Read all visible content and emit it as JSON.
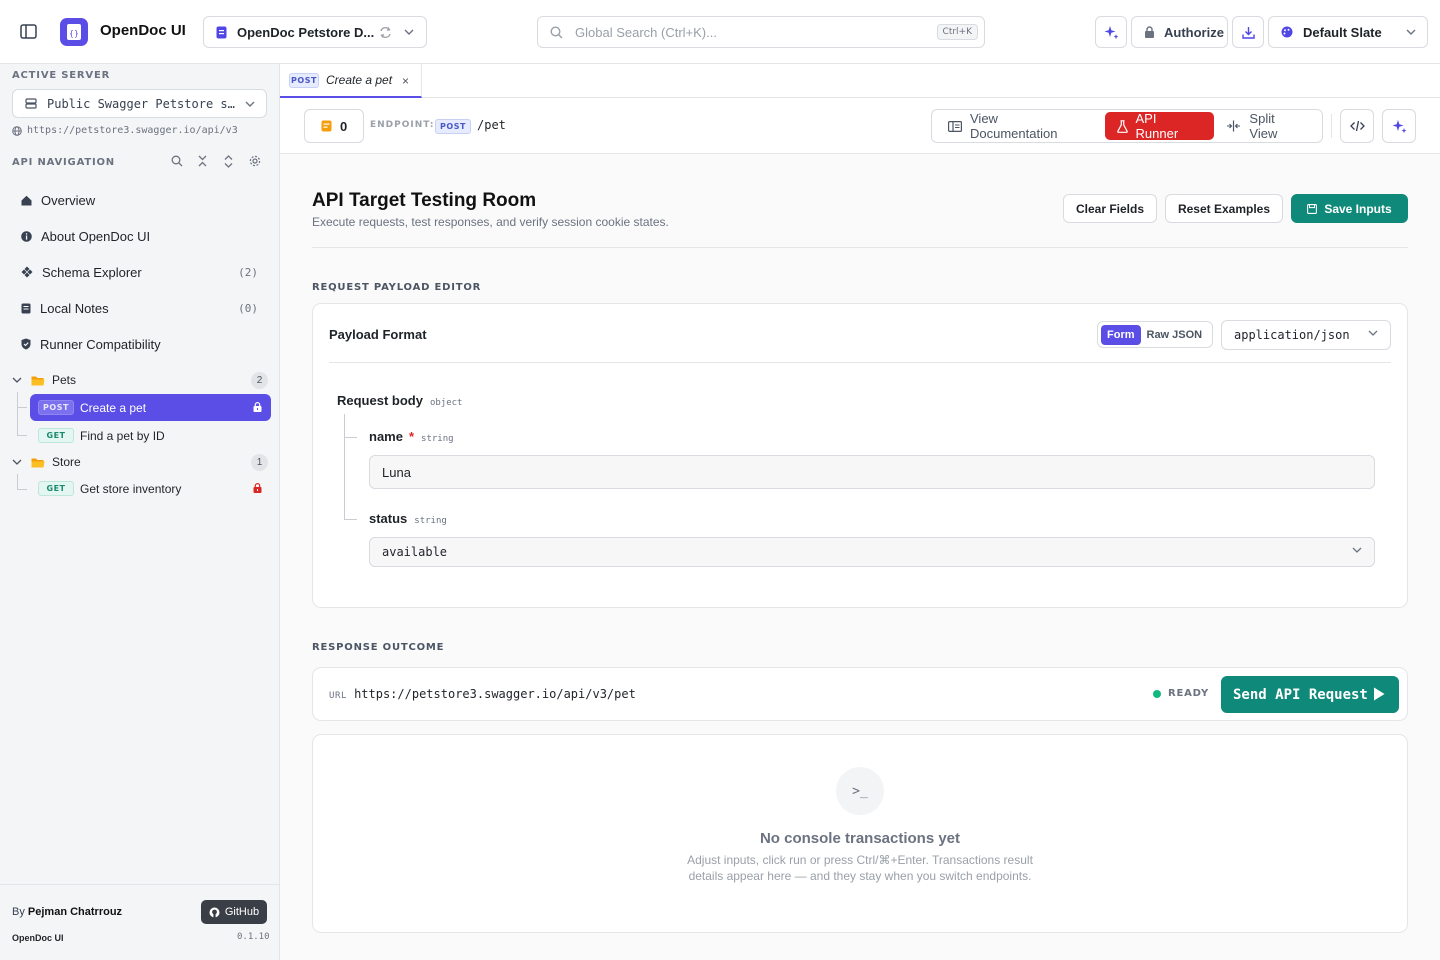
{
  "app": {
    "brand": "OpenDoc UI",
    "spec_selector": "OpenDoc Petstore D...",
    "search_placeholder": "Global Search (Ctrl+K)...",
    "search_kbd": "Ctrl+K",
    "authorize_label": "Authorize",
    "theme_label": "Default Slate",
    "accent": "#5b4ee6",
    "runner_red": "#dc2626",
    "success_teal": "#0f8a7a"
  },
  "sidebar": {
    "active_server_title": "ACTIVE SERVER",
    "server_name": "Public Swagger Petstore s…",
    "server_url": "https://petstore3.swagger.io/api/v3",
    "nav_title": "API NAVIGATION",
    "items": [
      {
        "label": "Overview",
        "icon": "home-icon",
        "count": ""
      },
      {
        "label": "About OpenDoc UI",
        "icon": "info-icon",
        "count": ""
      },
      {
        "label": "Schema Explorer",
        "icon": "schema-icon",
        "count": "(2)"
      },
      {
        "label": "Local Notes",
        "icon": "notes-icon",
        "count": "(0)"
      },
      {
        "label": "Runner Compatibility",
        "icon": "shield-icon",
        "count": ""
      }
    ],
    "groups": [
      {
        "label": "Pets",
        "count": "2",
        "endpoints": [
          {
            "method": "POST",
            "label": "Create a pet",
            "active": true,
            "lock": "locked"
          },
          {
            "method": "GET",
            "label": "Find a pet by ID",
            "active": false,
            "lock": ""
          }
        ]
      },
      {
        "label": "Store",
        "count": "1",
        "endpoints": [
          {
            "method": "GET",
            "label": "Get store inventory",
            "active": false,
            "lock": "locked-red"
          }
        ]
      }
    ],
    "footer": {
      "by": "By",
      "author": "Pejman Chatrrouz",
      "github_label": "GitHub",
      "app_name": "OpenDoc UI",
      "version": "0.1.10"
    }
  },
  "tab": {
    "method": "POST",
    "label": "Create a pet",
    "close": "×"
  },
  "endpoint_bar": {
    "notes_count": "0",
    "endpoint_label": "ENDPOINT:",
    "method": "POST",
    "path": "/pet",
    "view_buttons": [
      "View Documentation",
      "API Runner",
      "Split View"
    ]
  },
  "main": {
    "title": "API Target Testing Room",
    "subtitle": "Execute requests, test responses, and verify session cookie states.",
    "clear_label": "Clear Fields",
    "reset_label": "Reset Examples",
    "save_label": "Save Inputs",
    "payload_caption": "REQUEST PAYLOAD EDITOR",
    "payload_format_label": "Payload Format",
    "format_options": [
      "Form",
      "Raw JSON"
    ],
    "content_type": "application/json",
    "body_label": "Request body",
    "body_type": "object",
    "fields": [
      {
        "name": "name",
        "required": "*",
        "type": "string",
        "value": "Luna"
      },
      {
        "name": "status",
        "required": "",
        "type": "string",
        "value": "available"
      }
    ],
    "response_caption": "RESPONSE OUTCOME",
    "url_key": "URL",
    "url_value": "https://petstore3.swagger.io/api/v3/pet",
    "status_text": "READY",
    "send_label": "Send API Request",
    "empty_icon": ">_",
    "empty_title": "No console transactions yet",
    "empty_sub": "Adjust inputs, click run or press Ctrl/⌘+Enter. Transactions result details appear here — and they stay when you switch endpoints."
  }
}
